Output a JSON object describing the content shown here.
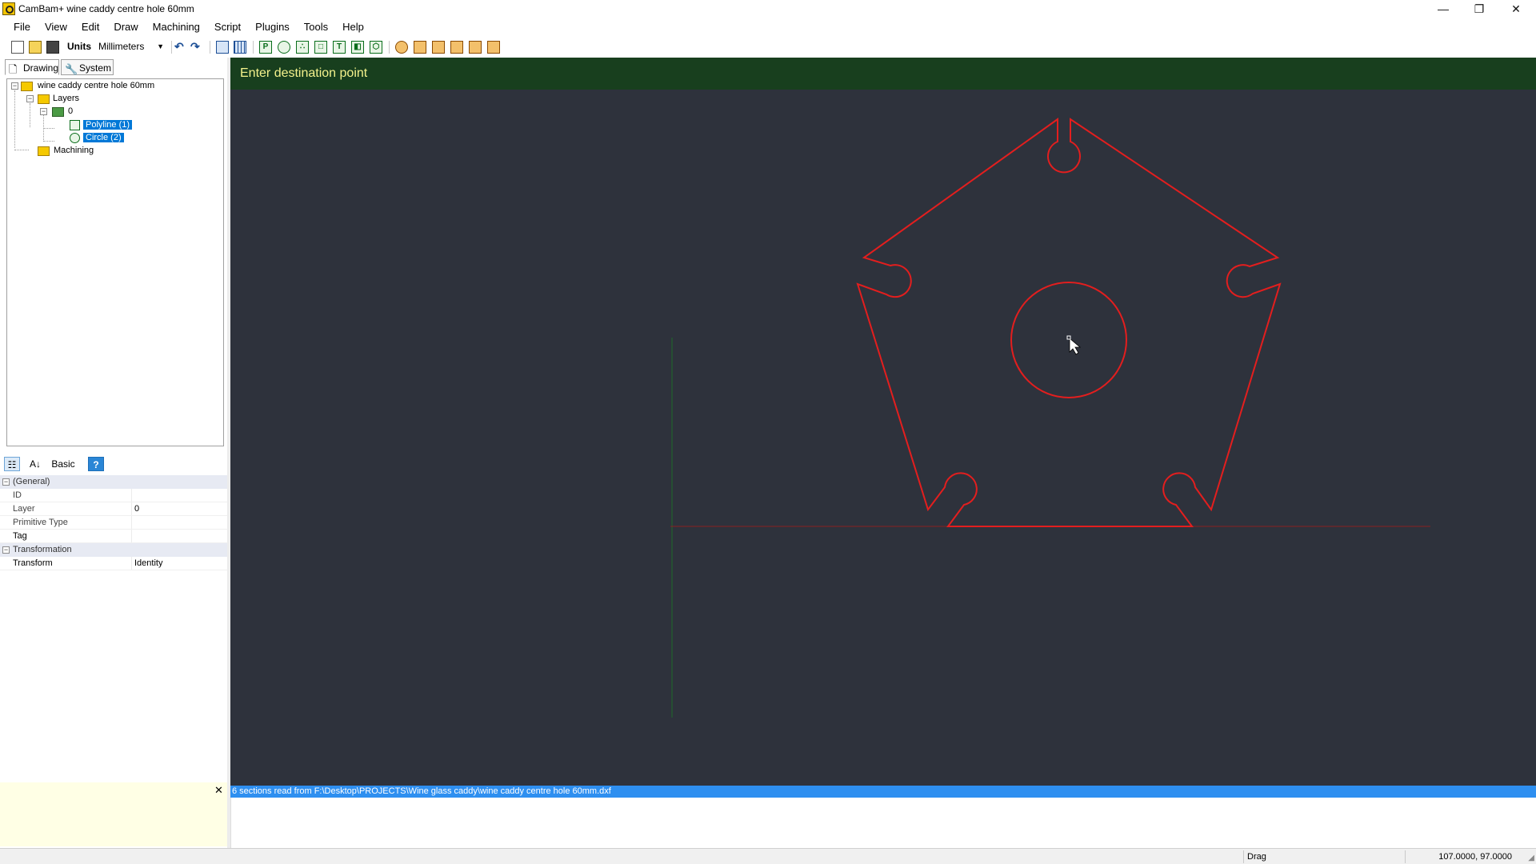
{
  "window": {
    "title": "CamBam+  wine caddy centre hole 60mm",
    "controls": [
      "—",
      "❐",
      "✕"
    ]
  },
  "menu": [
    "File",
    "View",
    "Edit",
    "Draw",
    "Machining",
    "Script",
    "Plugins",
    "Tools",
    "Help"
  ],
  "toolbar": {
    "units_label": "Units",
    "units_value": "Millimeters"
  },
  "left_tabs": {
    "drawing": "Drawing",
    "system": "System"
  },
  "tree": {
    "root": "wine caddy centre hole 60mm",
    "layers": "Layers",
    "layer0": "0",
    "polyline": "Polyline (1)",
    "circle": "Circle (2)",
    "machining": "Machining"
  },
  "props": {
    "toolbar_basic": "Basic",
    "cat_general": "(General)",
    "cat_transformation": "Transformation",
    "rows": [
      {
        "name": "ID",
        "value": ""
      },
      {
        "name": "Layer",
        "value": "0"
      },
      {
        "name": "Primitive Type",
        "value": ""
      },
      {
        "name": "Tag",
        "value": ""
      }
    ],
    "transform": {
      "name": "Transform",
      "value": "Identity"
    }
  },
  "canvas": {
    "prompt": "Enter destination point",
    "colors": {
      "background": "#2e323c",
      "header": "#183f1e",
      "prompt_text": "#f4f28c",
      "shape": "#e31e1e",
      "x_axis": "#8a2020",
      "y_axis": "#1f6a2a"
    }
  },
  "log": {
    "message": "6 sections read from F:\\Desktop\\PROJECTS\\Wine glass caddy\\wine caddy centre hole 60mm.dxf"
  },
  "status": {
    "mode": "Drag",
    "coords": "107.0000, 97.0000"
  }
}
